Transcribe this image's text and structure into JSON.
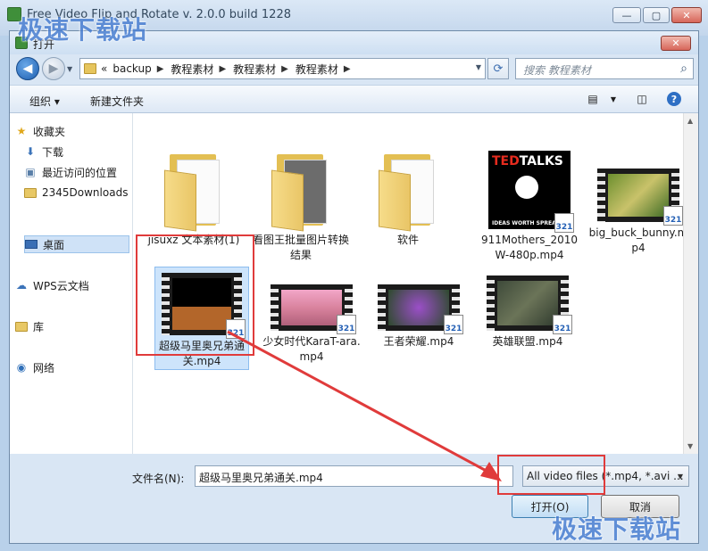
{
  "app": {
    "title": "Free Video Flip and Rotate  v. 2.0.0 build 1228",
    "watermark_top": "极速下载站",
    "watermark_bottom": "极速下载站"
  },
  "dialog": {
    "title": "打开",
    "close_symbol": "✕"
  },
  "nav": {
    "back_symbol": "◀",
    "forward_symbol": "▶",
    "address_prefix": "«",
    "breadcrumbs": [
      "backup",
      "教程素材",
      "教程素材",
      "教程素材"
    ],
    "refresh_symbol": "⟳",
    "search_placeholder": "搜索 教程素材"
  },
  "toolbar": {
    "organize_label": "组织 ▾",
    "new_folder_label": "新建文件夹"
  },
  "sidebar": {
    "items": [
      {
        "label": "收藏夹",
        "icon": "star-icon"
      },
      {
        "label": "下载",
        "icon": "download-icon"
      },
      {
        "label": "最近访问的位置",
        "icon": "recent-icon"
      },
      {
        "label": "2345Downloads",
        "icon": "folder-icon"
      },
      {
        "label": "桌面",
        "icon": "desktop-icon",
        "selected": true
      },
      {
        "label": "WPS云文档",
        "icon": "cloud-icon"
      },
      {
        "label": "库",
        "icon": "library-icon"
      },
      {
        "label": "网络",
        "icon": "network-icon"
      }
    ]
  },
  "files": [
    {
      "label": "jisuxz 文本素材(1)",
      "type": "folder"
    },
    {
      "label": "看图王批量图片转换结果",
      "type": "folder"
    },
    {
      "label": "软件",
      "type": "folder"
    },
    {
      "label": "911Mothers_2010W-480p.mp4",
      "type": "video"
    },
    {
      "label": "big_buck_bunny.mp4",
      "type": "video"
    },
    {
      "label": "超级马里奥兄弟通关.mp4",
      "type": "video",
      "selected": true
    },
    {
      "label": "少女时代KaraT-ara.mp4",
      "type": "video"
    },
    {
      "label": "王者荣耀.mp4",
      "type": "video"
    },
    {
      "label": "英雄联盟.mp4",
      "type": "video"
    }
  ],
  "thumbs": {
    "ted_top": "TED",
    "ted_talks": "TALKS",
    "ted_bottom": "IDEAS WORTH SPREADING",
    "badge": "321"
  },
  "footer": {
    "filename_label": "文件名(N):",
    "filename_value": "超级马里奥兄弟通关.mp4",
    "filetype_value": "All video files (*.mp4, *.avi ...",
    "open_button": "打开(O)",
    "cancel_button": "取消"
  }
}
